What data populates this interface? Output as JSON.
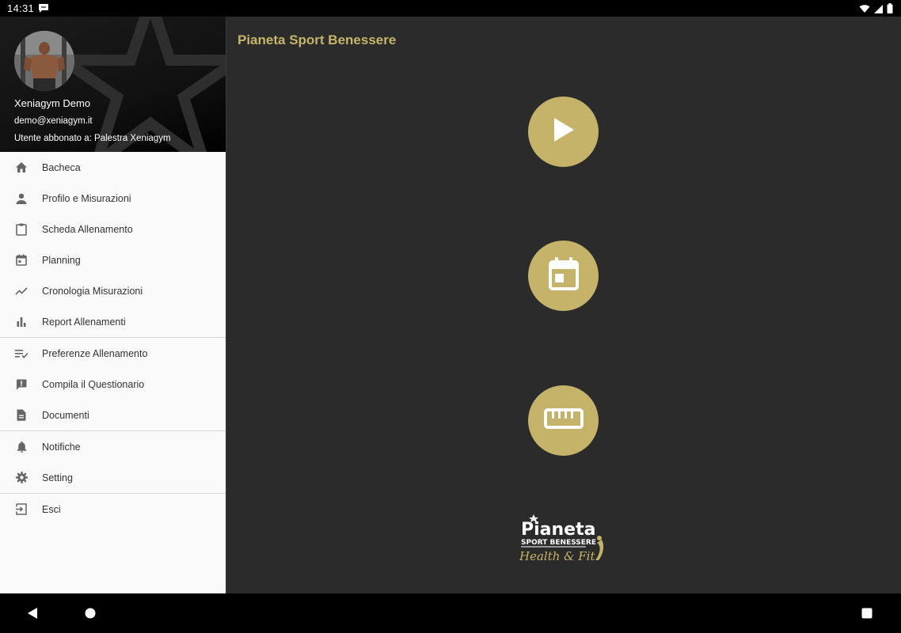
{
  "status_bar": {
    "time": "14:31"
  },
  "drawer": {
    "user_name": "Xeniagym Demo",
    "user_email": "demo@xeniagym.it",
    "subscription": "Utente abbonato a: Palestra Xeniagym",
    "items": [
      {
        "label": "Bacheca",
        "icon": "home-icon"
      },
      {
        "label": "Profilo e Misurazioni",
        "icon": "person-icon"
      },
      {
        "label": "Scheda Allenamento",
        "icon": "clipboard-icon"
      },
      {
        "label": "Planning",
        "icon": "calendar-icon"
      },
      {
        "label": "Cronologia Misurazioni",
        "icon": "trend-line-icon"
      },
      {
        "label": "Report Allenamenti",
        "icon": "bar-chart-icon"
      },
      {
        "label": "Preferenze Allenamento",
        "icon": "playlist-check-icon"
      },
      {
        "label": "Compila il Questionario",
        "icon": "feedback-icon"
      },
      {
        "label": "Documenti",
        "icon": "document-icon"
      },
      {
        "label": "Notifiche",
        "icon": "bell-icon"
      },
      {
        "label": "Setting",
        "icon": "gear-icon"
      },
      {
        "label": "Esci",
        "icon": "logout-icon"
      }
    ]
  },
  "main": {
    "title": "Pianeta Sport Benessere",
    "buttons": [
      {
        "name": "play-button",
        "icon": "play-icon"
      },
      {
        "name": "calendar-button",
        "icon": "calendar-icon"
      },
      {
        "name": "measure-button",
        "icon": "ruler-icon"
      }
    ],
    "logo": {
      "line1": "Pianeta",
      "line2": "SPORT BENESSERE",
      "line3": "Health & Fit"
    }
  },
  "colors": {
    "accent": "#c4b368",
    "title": "#c6b46a",
    "main_bg": "#2b2b2b",
    "drawer_bg": "#fafafa"
  }
}
